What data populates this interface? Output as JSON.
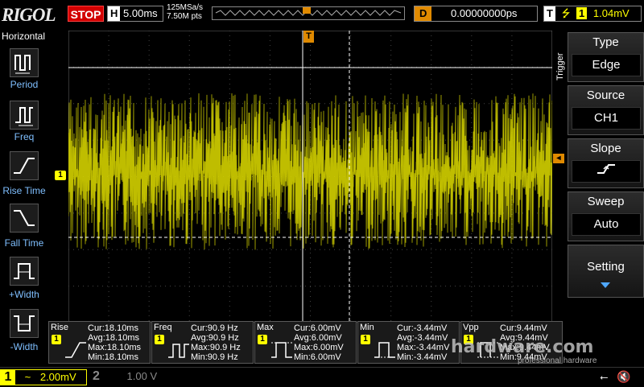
{
  "header": {
    "brand": "RIGOL",
    "run_state": "STOP",
    "timebase_label": "H",
    "timebase_value": "5.00ms",
    "sample_rate": "125MSa/s",
    "memory_points": "7.50M pts",
    "delay_label": "D",
    "delay_value": "0.00000000ps",
    "trigger_label": "T",
    "trigger_channel": "1",
    "trigger_level": "1.04mV"
  },
  "left_menu": {
    "title": "Horizontal",
    "items": [
      {
        "label": "Period",
        "icon": "period-icon"
      },
      {
        "label": "Freq",
        "icon": "frequency-icon"
      },
      {
        "label": "Rise Time",
        "icon": "rise-time-icon"
      },
      {
        "label": "Fall Time",
        "icon": "fall-time-icon"
      },
      {
        "label": "+Width",
        "icon": "positive-width-icon"
      },
      {
        "label": "-Width",
        "icon": "negative-width-icon"
      }
    ]
  },
  "right_menu": {
    "side_label": "Trigger",
    "keys": [
      {
        "title": "Type",
        "value": "Edge"
      },
      {
        "title": "Source",
        "value": "CH1"
      },
      {
        "title": "Slope",
        "value": ""
      },
      {
        "title": "Sweep",
        "value": "Auto"
      }
    ],
    "setting_label": "Setting"
  },
  "markers": {
    "channel1": "1",
    "trigger_position": "T"
  },
  "measurements": [
    {
      "name": "Rise",
      "channel": "1",
      "lines": [
        "Cur:18.10ms",
        "Avg:18.10ms",
        "Max:18.10ms",
        "Min:18.10ms"
      ]
    },
    {
      "name": "Freq",
      "channel": "1",
      "lines": [
        "Cur:90.9 Hz",
        "Avg:90.9 Hz",
        "Max:90.9 Hz",
        "Min:90.9 Hz"
      ]
    },
    {
      "name": "Max",
      "channel": "1",
      "lines": [
        "Cur:6.00mV",
        "Avg:6.00mV",
        "Max:6.00mV",
        "Min:6.00mV"
      ]
    },
    {
      "name": "Min",
      "channel": "1",
      "lines": [
        "Cur:-3.44mV",
        "Avg:-3.44mV",
        "Max:-3.44mV",
        "Min:-3.44mV"
      ]
    },
    {
      "name": "Vpp",
      "channel": "1",
      "lines": [
        "Cur:9.44mV",
        "Avg:9.44mV",
        "Max:9.44mV",
        "Min:9.44mV"
      ]
    }
  ],
  "footer": {
    "ch1_number": "1",
    "ch1_coupling": "~",
    "ch1_scale": "2.00mV",
    "ch2_number": "2",
    "ch2_scale": "1.00 V"
  },
  "watermark": {
    "text": "hardware.com",
    "subtext": "professional hardware"
  },
  "colors": {
    "ch1": "#ffff00",
    "trigger": "#e08a00",
    "stop": "#d20000",
    "menu_accent": "#4fa8ff"
  }
}
